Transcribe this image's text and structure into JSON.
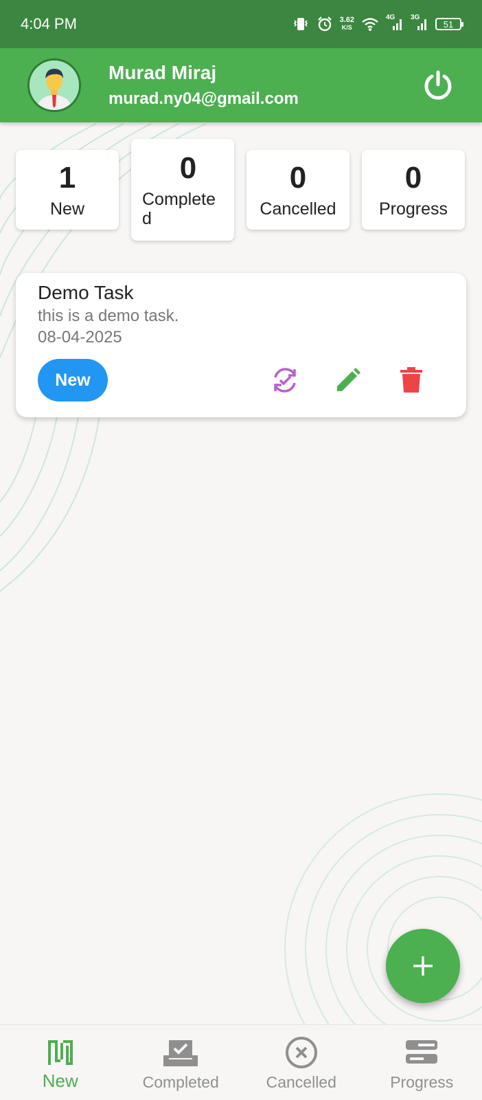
{
  "status_bar": {
    "time": "4:04 PM",
    "net_speed_value": "3.62",
    "net_speed_unit": "K/S",
    "network_4g": "4G",
    "network_3g": "3G",
    "battery": "51"
  },
  "header": {
    "user_name": "Murad Miraj",
    "user_email": "murad.ny04@gmail.com"
  },
  "summary": [
    {
      "count": "1",
      "label": "New"
    },
    {
      "count": "0",
      "label": "Complete d"
    },
    {
      "count": "0",
      "label": "Cancelled"
    },
    {
      "count": "0",
      "label": "Progress"
    }
  ],
  "tasks": [
    {
      "title": "Demo Task",
      "description": "this is a demo task.",
      "date": "08-04-2025",
      "status": "New"
    }
  ],
  "colors": {
    "primary": "#4caf50",
    "status_bar": "#3b873f",
    "chip_new": "#2196f3",
    "change_status_icon": "#b760c9",
    "edit_icon": "#4caf50",
    "delete_icon": "#ef4444"
  },
  "icons": {
    "logout": "power-icon",
    "change_status": "sync-check-icon",
    "edit": "pencil-icon",
    "delete": "trash-icon",
    "fab": "plus-icon"
  },
  "bottom_nav": [
    {
      "label": "New",
      "icon": "new-tasks-icon",
      "active": true
    },
    {
      "label": "Completed",
      "icon": "completed-tasks-icon",
      "active": false
    },
    {
      "label": "Cancelled",
      "icon": "cancelled-tasks-icon",
      "active": false
    },
    {
      "label": "Progress",
      "icon": "progress-tasks-icon",
      "active": false
    }
  ]
}
